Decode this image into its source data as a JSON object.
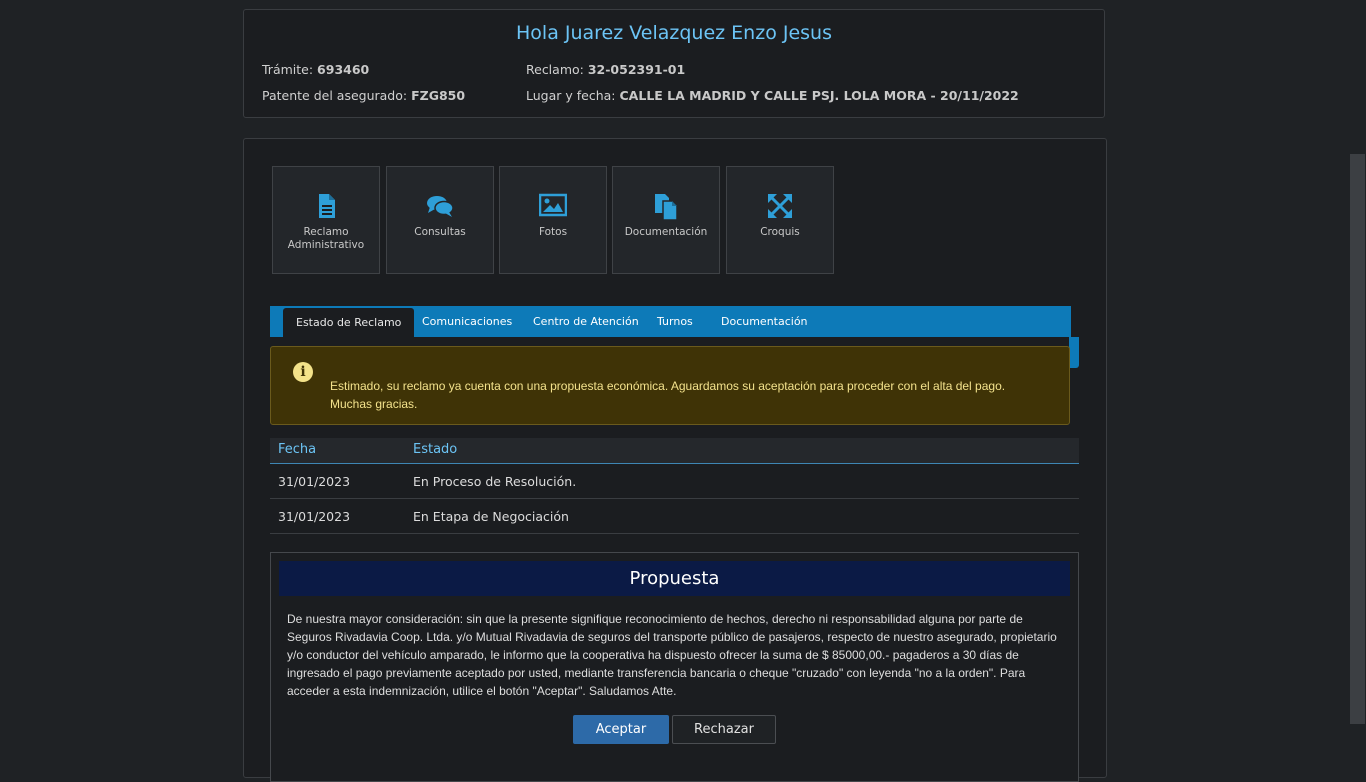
{
  "header": {
    "greeting": "Hola Juarez Velazquez Enzo Jesus",
    "tramite_label": "Trámite:",
    "tramite_value": "693460",
    "reclamo_label": "Reclamo:",
    "reclamo_value": "32-052391-01",
    "patente_label": "Patente del asegurado:",
    "patente_value": "FZG850",
    "lugar_label": "Lugar y fecha:",
    "lugar_value": "CALLE LA MADRID Y CALLE PSJ. LOLA MORA - 20/11/2022"
  },
  "tiles": [
    {
      "label": "Reclamo Administrativo",
      "icon": "file-text-icon"
    },
    {
      "label": "Consultas",
      "icon": "comments-icon"
    },
    {
      "label": "Fotos",
      "icon": "image-icon"
    },
    {
      "label": "Documentación",
      "icon": "copy-icon"
    },
    {
      "label": "Croquis",
      "icon": "expand-arrows-icon"
    }
  ],
  "tabs": [
    "Estado de Reclamo",
    "Comunicaciones",
    "Centro de Atención",
    "Turnos",
    "Documentación"
  ],
  "alert": {
    "line1": "Estimado, su reclamo ya cuenta con una propuesta económica. Aguardamos su aceptación para proceder con el alta del pago.",
    "line2": "Muchas gracias."
  },
  "table": {
    "headers": [
      "Fecha",
      "Estado"
    ],
    "rows": [
      [
        "31/01/2023",
        "En Proceso de Resolución."
      ],
      [
        "31/01/2023",
        "En Etapa de Negociación"
      ]
    ]
  },
  "proposal": {
    "title": "Propuesta",
    "body": "De nuestra mayor consideración: sin que la presente signifique reconocimiento de hechos, derecho ni responsabilidad alguna por parte de Seguros Rivadavia Coop. Ltda. y/o Mutual Rivadavia de seguros del transporte público de pasajeros, respecto de nuestro asegurado, propietario y/o conductor del vehículo amparado, le informo que la cooperativa ha dispuesto ofrecer la suma de $ 85000,00.- pagaderos a 30 días de ingresado el pago previamente aceptado por usted, mediante transferencia bancaria o cheque \"cruzado\" con leyenda \"no a la orden\". Para acceder a esta indemnización, utilice el botón \"Aceptar\". Saludamos Atte.",
    "accept_label": "Aceptar",
    "reject_label": "Rechazar"
  },
  "colors": {
    "accent": "#0d7ab8",
    "greeting": "#6cc4f5",
    "alert_bg": "#3f3306",
    "alert_text": "#f3e28c",
    "proposal_title_bg": "#0b1a45",
    "accept_button": "#2d6aa8"
  }
}
